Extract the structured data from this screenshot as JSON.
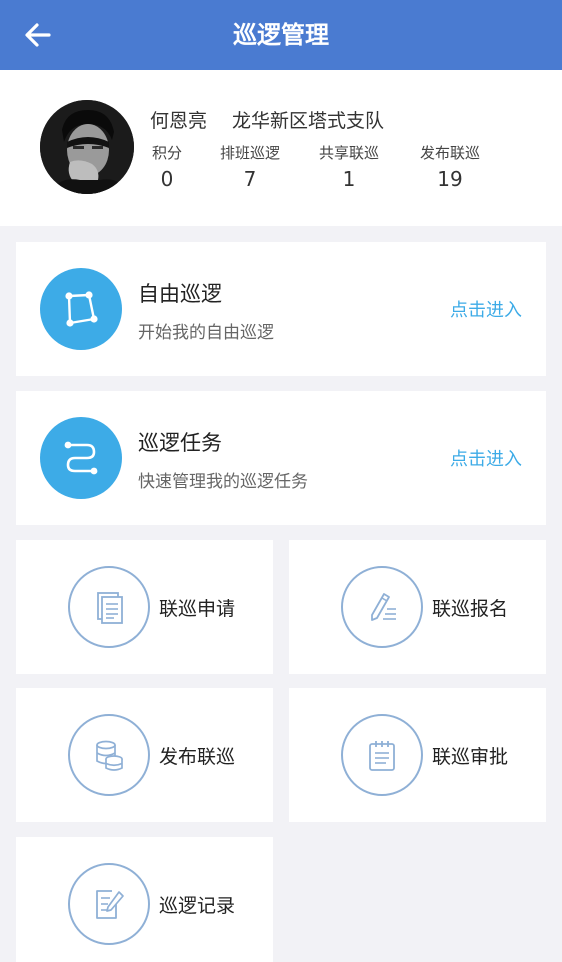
{
  "header": {
    "title": "巡逻管理",
    "back_icon": "arrow-left-icon"
  },
  "profile": {
    "name": "何恩亮",
    "unit": "龙华新区塔式支队",
    "stats": [
      {
        "label": "积分",
        "value": "0"
      },
      {
        "label": "排班巡逻",
        "value": "7"
      },
      {
        "label": "共享联巡",
        "value": "1"
      },
      {
        "label": "发布联巡",
        "value": "19"
      }
    ]
  },
  "cards": {
    "free_patrol": {
      "title": "自由巡逻",
      "subtitle": "开始我的自由巡逻",
      "link": "点击进入",
      "icon": "polygon-route-icon"
    },
    "patrol_task": {
      "title": "巡逻任务",
      "subtitle": "快速管理我的巡逻任务",
      "link": "点击进入",
      "icon": "route-path-icon"
    }
  },
  "grid": [
    {
      "label": "联巡申请",
      "icon": "document-icon"
    },
    {
      "label": "联巡报名",
      "icon": "pen-write-icon"
    },
    {
      "label": "发布联巡",
      "icon": "database-stack-icon"
    },
    {
      "label": "联巡审批",
      "icon": "notepad-icon"
    },
    {
      "label": "巡逻记录",
      "icon": "edit-record-icon"
    }
  ],
  "colors": {
    "header": "#4a7bd1",
    "accent": "#3dabe7",
    "icon_outline": "#8fb0d6",
    "background": "#f2f2f6"
  }
}
